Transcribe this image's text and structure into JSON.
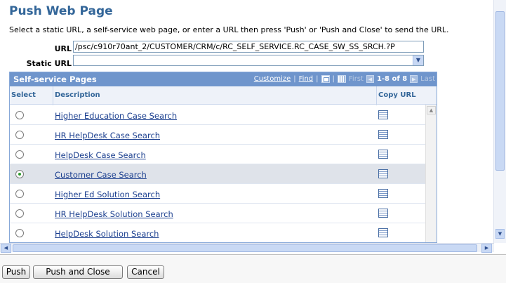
{
  "title": "Push Web Page",
  "instructions": "Select a static URL, a self-service web page, or enter a URL then press 'Push' or 'Push and Close' to send the URL.",
  "url_field": {
    "label": "URL",
    "value": "/psc/c910r70ant_2/CUSTOMER/CRM/c/RC_SELF_SERVICE.RC_CASE_SW_SS_SRCH.?P"
  },
  "static_url_field": {
    "label": "Static URL",
    "value": ""
  },
  "grid": {
    "title": "Self-service Pages",
    "nav": {
      "customize": "Customize",
      "find": "Find",
      "first": "First",
      "range": "1-8 of 8",
      "last": "Last"
    },
    "columns": {
      "select": "Select",
      "description": "Description",
      "copy_url": "Copy URL"
    },
    "rows": [
      {
        "description": "Higher Education Case Search",
        "selected": false
      },
      {
        "description": "HR HelpDesk Case Search",
        "selected": false
      },
      {
        "description": "HelpDesk Case Search",
        "selected": false
      },
      {
        "description": "Customer Case Search",
        "selected": true
      },
      {
        "description": "Higher Ed Solution Search",
        "selected": false
      },
      {
        "description": "HR HelpDesk Solution Search",
        "selected": false
      },
      {
        "description": "HelpDesk Solution Search",
        "selected": false
      }
    ]
  },
  "buttons": {
    "push": "Push",
    "push_close": "Push and Close",
    "cancel": "Cancel"
  },
  "icons": {
    "zoom": "zoom-icon",
    "download": "grid-download-icon",
    "copy": "copy-url-icon"
  },
  "colors": {
    "title": "#336699",
    "grid_header": "#6f95cc",
    "selected_row": "#dfe3ea",
    "link": "#1b3f8f"
  }
}
